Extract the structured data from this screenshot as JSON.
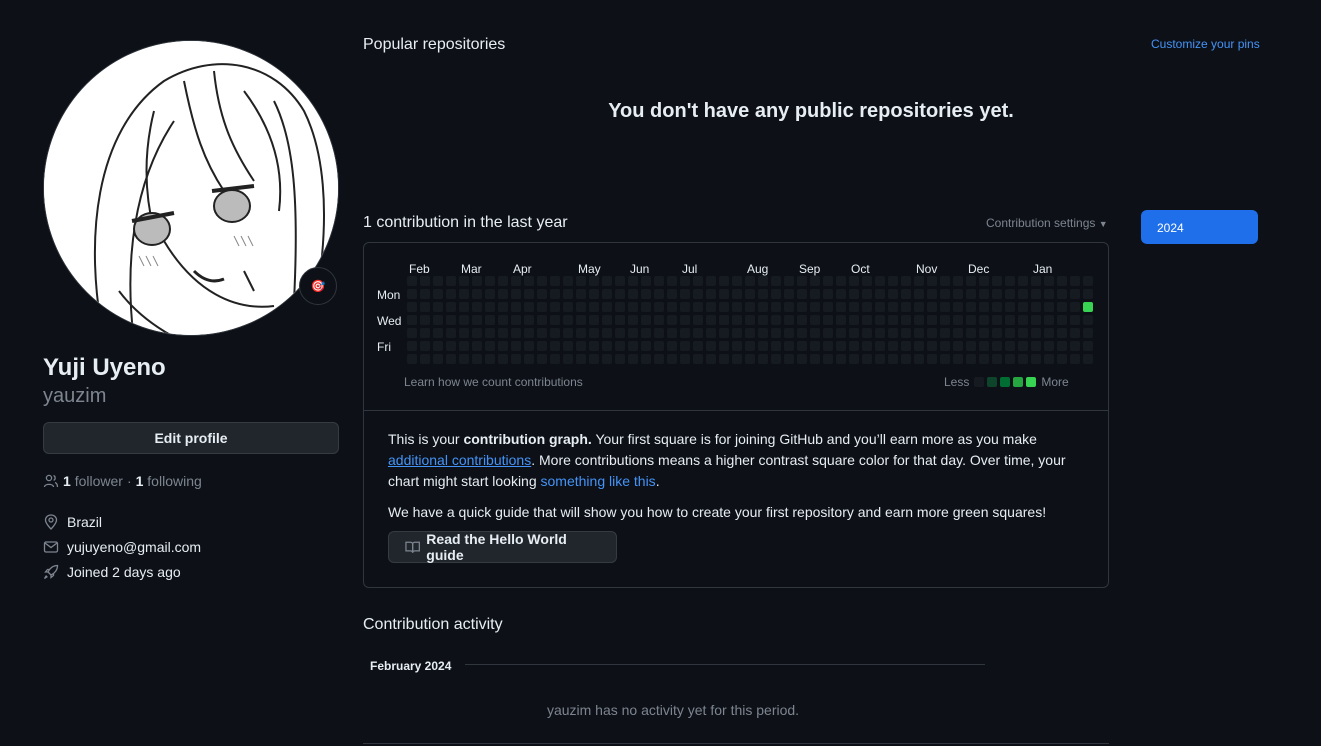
{
  "profile": {
    "full_name": "Yuji Uyeno",
    "login": "yauzim",
    "edit_label": "Edit profile",
    "followers_count": "1",
    "followers_label": "follower",
    "separator": "·",
    "following_count": "1",
    "following_label": "following",
    "location": "Brazil",
    "email": "yujuyeno@gmail.com",
    "joined": "Joined 2 days ago",
    "status_emoji": "🎯"
  },
  "pinned": {
    "title": "Popular repositories",
    "customize_label": "Customize your pins",
    "empty_message": "You don't have any public repositories yet."
  },
  "contributions": {
    "title": "1 contribution in the last year",
    "settings_label": "Contribution settings",
    "year_selected": "2024",
    "months": [
      "Feb",
      "Mar",
      "Apr",
      "May",
      "Jun",
      "Jul",
      "Aug",
      "Sep",
      "Oct",
      "Nov",
      "Dec",
      "Jan"
    ],
    "days": [
      "Mon",
      "Wed",
      "Fri"
    ],
    "learn_label": "Learn how we count contributions",
    "legend_less": "Less",
    "legend_more": "More",
    "colors": {
      "empty": "#161b22",
      "level1": "#0e4429",
      "level2": "#006d32",
      "level3": "#26a641",
      "level4": "#39d353"
    },
    "weeks": 53,
    "active_cell": {
      "week": 52,
      "day": 2,
      "level": 4
    }
  },
  "tip": {
    "intro": "This is your",
    "bold": "contribution graph.",
    "text1": "Your first square is for joining GitHub and you’ll earn more as you make",
    "link1": "additional contributions",
    "text2": ". More contributions means a higher contrast square color for that day. Over time, your chart might start looking",
    "link2": "something like this",
    "text3": ".",
    "guide_text": "We have a quick guide that will show you how to create your first repository and earn more green squares!",
    "guide_button": "Read the Hello World guide"
  },
  "activity": {
    "title": "Contribution activity",
    "month": "February 2024",
    "empty_message": "yauzim has no activity yet for this period."
  }
}
